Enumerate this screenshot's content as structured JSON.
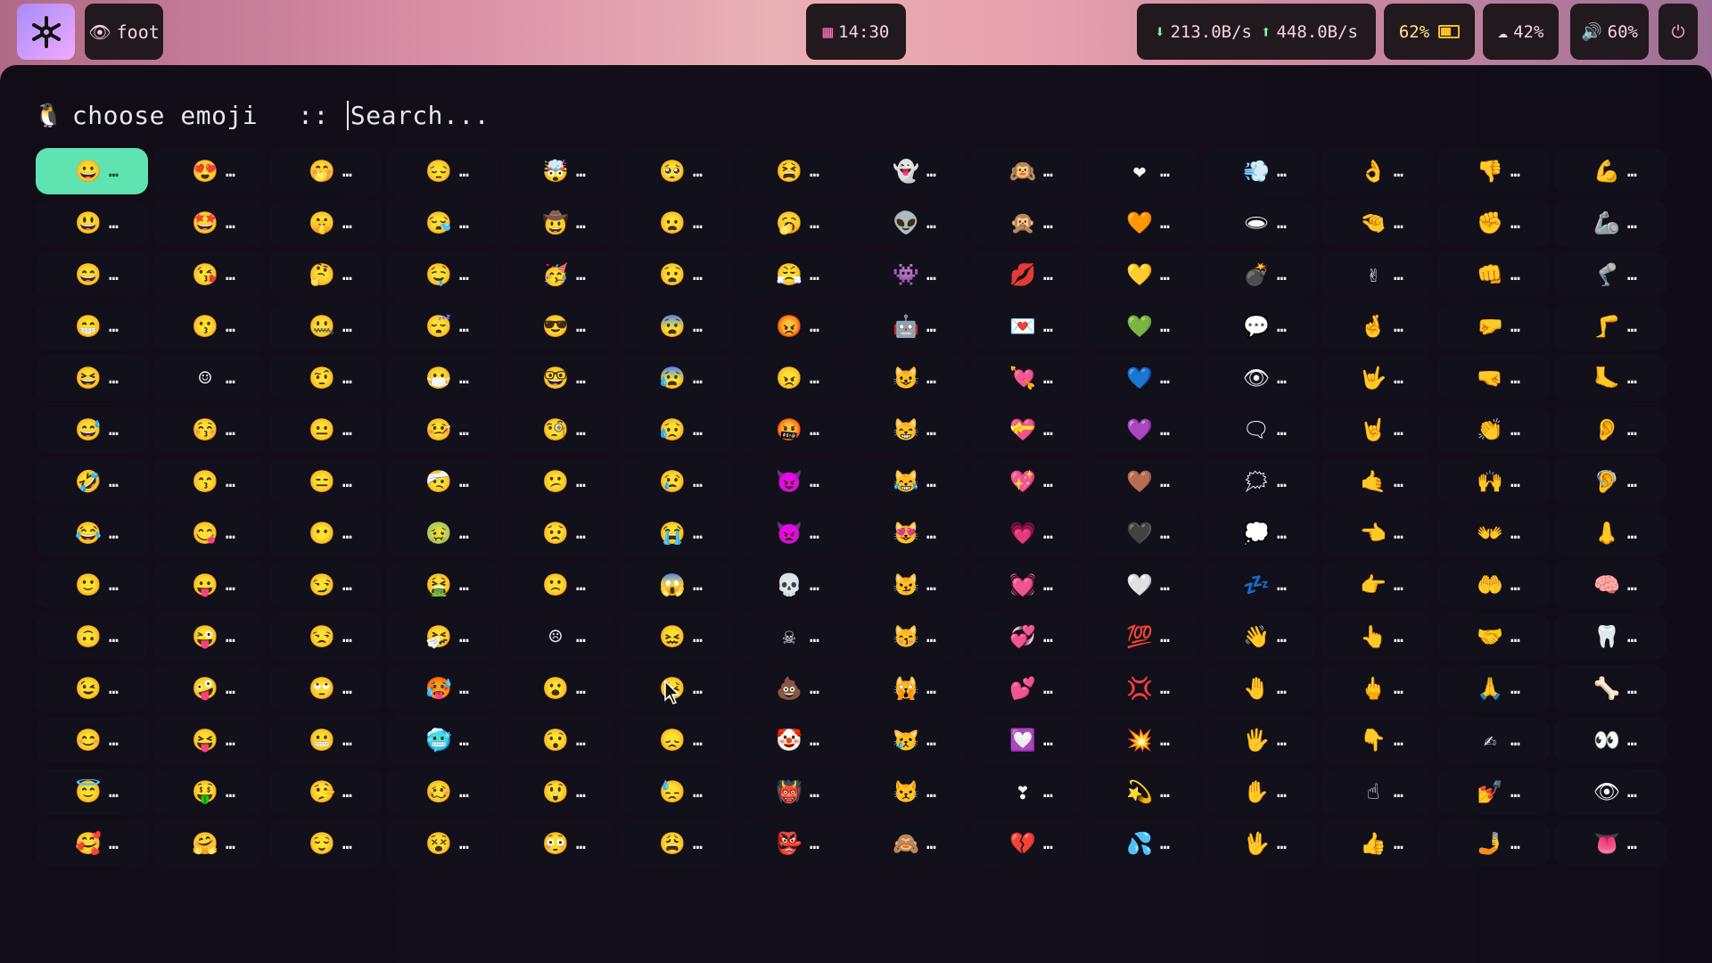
{
  "topbar": {
    "window_title": "foot",
    "window_icon": "eye-icon",
    "clock": "14:30",
    "net_down": "213.0B/s",
    "net_up": "448.0B/s",
    "battery": "62%",
    "weather": "42%",
    "volume": "60%",
    "colors": {
      "pill_bg": "#22191f",
      "pill_text": "#f2d6dd"
    }
  },
  "launcher": {
    "prompt_icon": "🐧",
    "prompt": "choose emoji",
    "separator": "::",
    "search_placeholder": "Search...",
    "ellipsis": "…",
    "selected_color": "#5fe3b0",
    "columns": [
      [
        "😀",
        "😃",
        "😄",
        "😁",
        "😆",
        "😅",
        "🤣",
        "😂",
        "🙂",
        "🙃",
        "😉",
        "😊",
        "😇",
        "🥰"
      ],
      [
        "😍",
        "🤩",
        "😘",
        "😗",
        "☺",
        "😚",
        "😙",
        "😋",
        "😛",
        "😜",
        "🤪",
        "😝",
        "🤑",
        "🤗"
      ],
      [
        "🤭",
        "🤫",
        "🤔",
        "🤐",
        "🤨",
        "😐",
        "😑",
        "😶",
        "😏",
        "😒",
        "🙄",
        "😬",
        "🤥",
        "😌"
      ],
      [
        "😔",
        "😪",
        "🤤",
        "😴",
        "😷",
        "🤒",
        "🤕",
        "🤢",
        "🤮",
        "🤧",
        "🥵",
        "🥶",
        "🥴",
        "😵"
      ],
      [
        "🤯",
        "🤠",
        "🥳",
        "😎",
        "🤓",
        "🧐",
        "😕",
        "😟",
        "🙁",
        "☹",
        "😮",
        "😯",
        "😲",
        "😳"
      ],
      [
        "🥺",
        "😦",
        "😧",
        "😨",
        "😰",
        "😥",
        "😢",
        "😭",
        "😱",
        "😖",
        "😣",
        "😞",
        "😓",
        "😩"
      ],
      [
        "😫",
        "🥱",
        "😤",
        "😡",
        "😠",
        "🤬",
        "😈",
        "👿",
        "💀",
        "☠",
        "💩",
        "🤡",
        "👹",
        "👺"
      ],
      [
        "👻",
        "👽",
        "👾",
        "🤖",
        "😺",
        "😸",
        "😹",
        "😻",
        "😼",
        "😽",
        "🙀",
        "😿",
        "😾",
        "🙈"
      ],
      [
        "🙉",
        "🙊",
        "💋",
        "💌",
        "💘",
        "💝",
        "💖",
        "💗",
        "💓",
        "💞",
        "💕",
        "💟",
        "❣",
        "💔"
      ],
      [
        "❤",
        "🧡",
        "💛",
        "💚",
        "💙",
        "💜",
        "🤎",
        "🖤",
        "🤍",
        "💯",
        "💢",
        "💥",
        "💫",
        "💦"
      ],
      [
        "💨",
        "🕳",
        "💣",
        "💬",
        "👁",
        "🗨",
        "🗯",
        "💭",
        "💤",
        "👋",
        "🤚",
        "🖐",
        "✋",
        "🖖"
      ],
      [
        "👌",
        "🤏",
        "✌",
        "🤞",
        "🤟",
        "🤘",
        "🤙",
        "👈",
        "👉",
        "👆",
        "🖕",
        "👇",
        "☝",
        "👍"
      ],
      [
        "👎",
        "✊",
        "👊",
        "🤛",
        "🤜",
        "👏",
        "🙌",
        "👐",
        "🤲",
        "🤝",
        "🙏",
        "✍",
        "💅",
        "🤳"
      ],
      [
        "💪",
        "🦾",
        "🦿",
        "🦵",
        "🦶",
        "👂",
        "🦻",
        "👃",
        "🧠",
        "🦷",
        "🦴",
        "👀",
        "👁",
        "👅"
      ]
    ]
  }
}
